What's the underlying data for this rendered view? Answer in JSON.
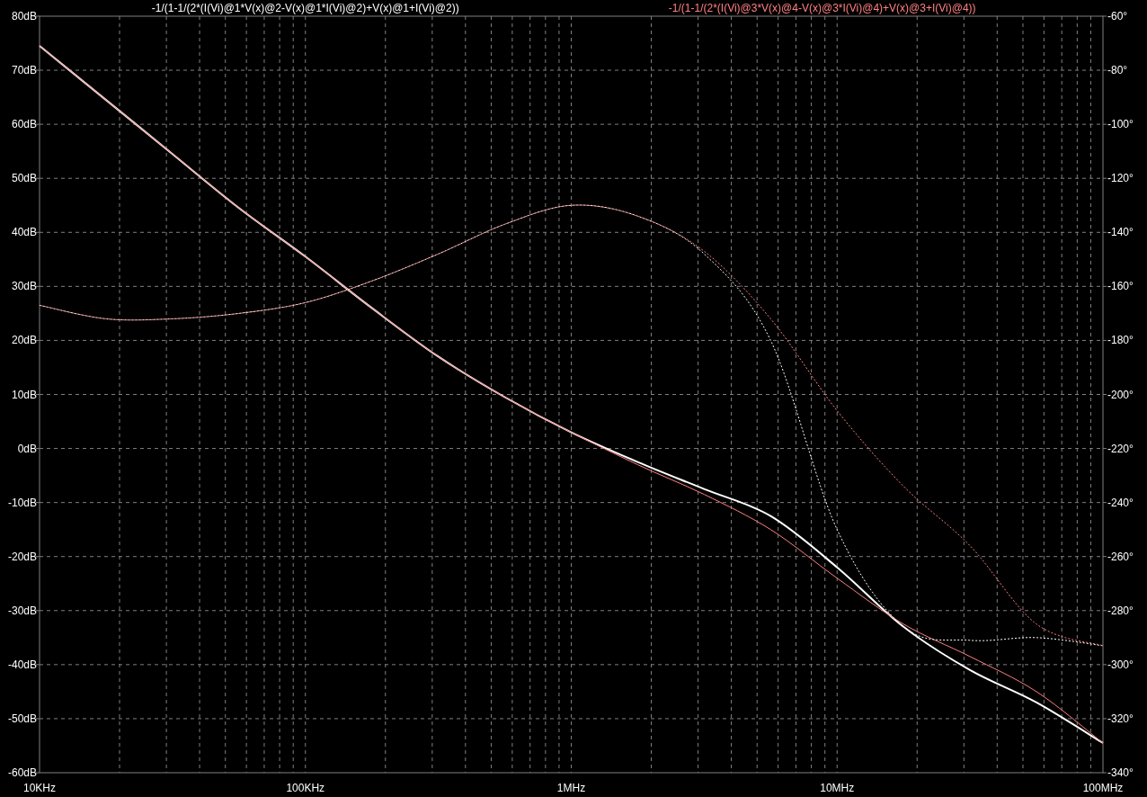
{
  "plot": {
    "traces": [
      {
        "label": "-1/(1-1/(2*(I(Vi)@1*V(x)@2-V(x)@1*I(Vi)@2)+V(x)@1+I(Vi)@2))",
        "color": "#ffffff"
      },
      {
        "label": "-1/(1-1/(2*(I(Vi)@3*V(x)@4-V(x)@3*I(Vi)@4)+V(x)@3+I(Vi)@4))",
        "color": "#ff8080"
      }
    ],
    "chart_data": {
      "type": "line",
      "categories": [
        "10KHz",
        null,
        null,
        null,
        "100KHz",
        null,
        null,
        null,
        "1MHz",
        null,
        null,
        null,
        "10MHz",
        null,
        null,
        null,
        "100MHz"
      ],
      "grid": true,
      "ylim": [
        -60,
        80
      ],
      "y2lim": [
        -340,
        -60
      ],
      "yticks": [
        {
          "value": 80,
          "label": "80dB"
        },
        {
          "value": 70,
          "label": "70dB"
        },
        {
          "value": 60,
          "label": "60dB"
        },
        {
          "value": 50,
          "label": "50dB"
        },
        {
          "value": 40,
          "label": "40dB"
        },
        {
          "value": 30,
          "label": "30dB"
        },
        {
          "value": 20,
          "label": "20dB"
        },
        {
          "value": 10,
          "label": "10dB"
        },
        {
          "value": 0,
          "label": "0dB"
        },
        {
          "value": -10,
          "label": "-10dB"
        },
        {
          "value": -20,
          "label": "-20dB"
        },
        {
          "value": -30,
          "label": "-30dB"
        },
        {
          "value": -40,
          "label": "-40dB"
        },
        {
          "value": -50,
          "label": "-50dB"
        },
        {
          "value": -60,
          "label": "-60dB"
        }
      ],
      "y2ticks": [
        {
          "value": -60,
          "label": "-60°"
        },
        {
          "value": -80,
          "label": "-80°"
        },
        {
          "value": -100,
          "label": "-100°"
        },
        {
          "value": -120,
          "label": "-120°"
        },
        {
          "value": -140,
          "label": "-140°"
        },
        {
          "value": -160,
          "label": "-160°"
        },
        {
          "value": -180,
          "label": "-180°"
        },
        {
          "value": -200,
          "label": "-200°"
        },
        {
          "value": -220,
          "label": "-220°"
        },
        {
          "value": -240,
          "label": "-240°"
        },
        {
          "value": -260,
          "label": "-260°"
        },
        {
          "value": -280,
          "label": "-280°"
        },
        {
          "value": -300,
          "label": "-300°"
        },
        {
          "value": -320,
          "label": "-320°"
        },
        {
          "value": -340,
          "label": "-340°"
        }
      ],
      "series": [
        {
          "color": "#ffffff",
          "values": [
            74.5,
            64.5,
            54.5,
            44.5,
            35.5,
            26,
            17,
            9.5,
            3,
            -2.5,
            -7.5,
            -12.5,
            -22,
            -33,
            -41,
            -47,
            -54.5
          ]
        },
        {
          "axis": "y2",
          "line_style": "dashed",
          "color": "#ffffff",
          "values": [
            -167,
            -172,
            -172,
            -170,
            -166,
            -158,
            -148,
            -137,
            -130,
            -134,
            -148,
            -180,
            -250,
            -286,
            -291,
            -290,
            -293
          ]
        },
        {
          "color": "#ff8080",
          "values": [
            74.5,
            64.5,
            54.5,
            44.5,
            35.5,
            26,
            17,
            9.5,
            3,
            -3,
            -8.5,
            -15,
            -24,
            -32.5,
            -38.5,
            -45,
            -54.5
          ]
        },
        {
          "axis": "y2",
          "line_style": "dashed",
          "color": "#ff8080",
          "values": [
            -167,
            -172,
            -172,
            -170,
            -166,
            -158,
            -148,
            -137,
            -130,
            -134,
            -147,
            -172,
            -206,
            -234,
            -256,
            -285,
            -293
          ]
        }
      ]
    }
  }
}
